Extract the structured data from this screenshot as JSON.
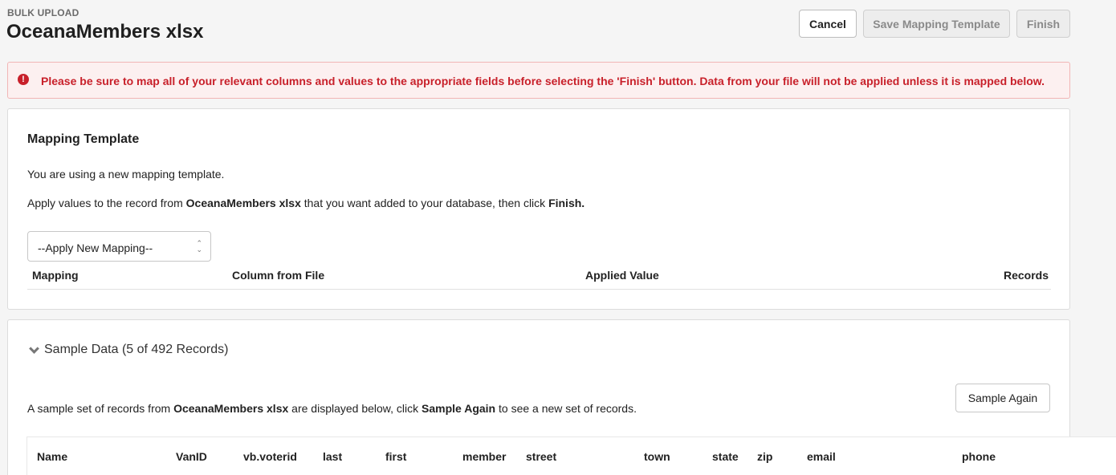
{
  "header": {
    "eyebrow": "BULK UPLOAD",
    "title": "OceanaMembers xlsx",
    "buttons": {
      "cancel": "Cancel",
      "save_mapping_template": "Save Mapping Template",
      "finish": "Finish"
    }
  },
  "alert": {
    "icon": "exclamation-circle-icon",
    "color": "#c8202a",
    "text": "Please be sure to map all of your relevant columns and values to the appropriate fields before selecting the 'Finish' button. Data from your file will not be applied unless it is mapped below."
  },
  "mapping_template": {
    "title": "Mapping Template",
    "intro": "You are using a new mapping template.",
    "apply_prefix": "Apply values to the record from ",
    "file_name": "OceanaMembers xlsx",
    "apply_middle": " that you want added to your database, then click ",
    "apply_action": "Finish.",
    "select": {
      "selected": "--Apply New Mapping--"
    },
    "columns": [
      "Mapping",
      "Column from File",
      "Applied Value",
      "Records"
    ]
  },
  "sample_data": {
    "toggle_label": "Sample Data (5 of 492 Records)",
    "desc_prefix": "A sample set of records from ",
    "file_name": "OceanaMembers xlsx",
    "desc_middle": " are displayed below, click ",
    "desc_action": "Sample Again",
    "desc_suffix": " to see a new set of records.",
    "sample_again_button": "Sample Again",
    "columns": [
      "Name",
      "VanID",
      "vb.voterid",
      "last",
      "first",
      "member",
      "street",
      "town",
      "state",
      "zip",
      "email",
      "phone"
    ]
  }
}
